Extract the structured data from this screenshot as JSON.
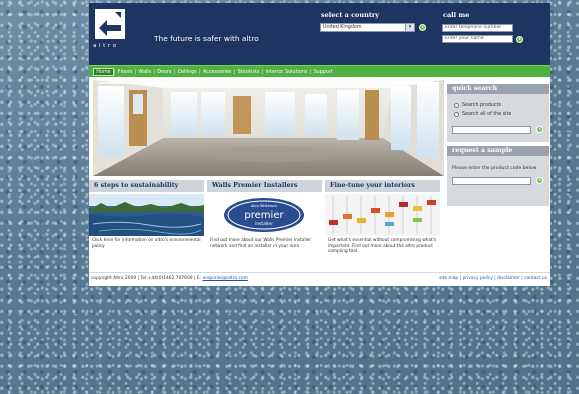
{
  "header": {
    "logo_word": "altro",
    "tagline": "The future is safer with altro",
    "country": {
      "title": "select a country",
      "selected": "United Kingdom"
    },
    "call": {
      "title": "call me",
      "phone_placeholder": "Enter telephone number",
      "name_placeholder": "Enter your name"
    }
  },
  "nav": {
    "items": [
      "Home",
      "Floors",
      "Walls",
      "Doors",
      "Ceilings",
      "Accessories",
      "Stockists",
      "Interior Solutions",
      "Support"
    ]
  },
  "quick_search": {
    "title": "quick search",
    "options": [
      "Search products",
      "Search all of the site"
    ]
  },
  "request_sample": {
    "title": "request a sample",
    "prompt": "Please enter the product code below"
  },
  "features": [
    {
      "title": "6 steps to sustainability",
      "text": "Click here for information on altro's environmental policy"
    },
    {
      "title": "Walls Premier Installers",
      "badge_top": "Altro Whiterock",
      "badge_main": "premier",
      "badge_sub": "installer",
      "text": "Find out more about our Walls Premier installer network and find an installer in your area"
    },
    {
      "title": "Fine-tune your interiors",
      "text": "Get what's essential without compromising what's important. Find out more about the altro product sampling tool."
    }
  ],
  "footer": {
    "copyright": "copyright Altro 2009 | Tel:+44(0)1462 707600 | E:",
    "email": "enquiries@altro.com",
    "links": [
      "site map",
      "privacy policy",
      "disclaimer",
      "contact us"
    ]
  },
  "colors": {
    "header_bg": "#1d3561",
    "nav_green": "#4fb240",
    "go_button": "#6fc144",
    "panel_title": "#9aa3ad",
    "background": "#5b7d95"
  },
  "icons": {
    "go": "go-arrow-icon",
    "select": "chevron-down-icon"
  }
}
